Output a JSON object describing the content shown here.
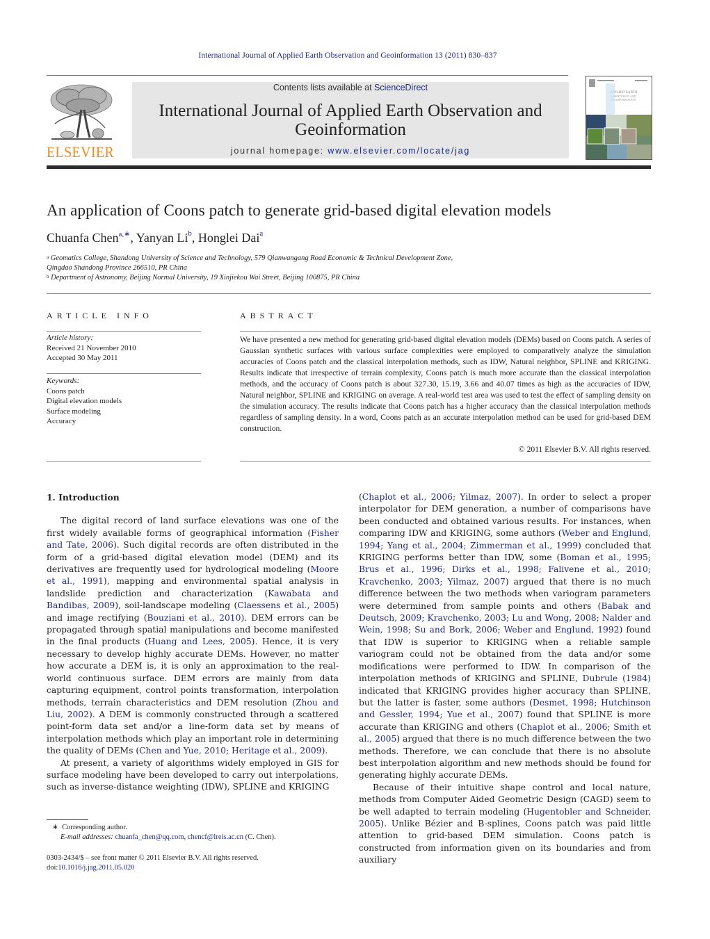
{
  "running_head": "International Journal of Applied Earth Observation and Geoinformation 13 (2011) 830–837",
  "masthead": {
    "publisher_logo_text": "ELSEVIER",
    "contents_prefix": "Contents lists available at ",
    "contents_link": "ScienceDirect",
    "journal_title": "International Journal of Applied Earth Observation and Geoinformation",
    "homepage_prefix": "journal homepage: ",
    "homepage_link": "www.elsevier.com/locate/jag",
    "cover_title": "APPLIED EARTH OBSERVATION AND GEOINFORMATION"
  },
  "article": {
    "title": "An application of Coons patch to generate grid-based digital elevation models",
    "authors": [
      {
        "name": "Chuanfa Chen",
        "sup": "a,∗"
      },
      {
        "name": "Yanyan Li",
        "sup": "b"
      },
      {
        "name": "Honglei Dai",
        "sup": "a"
      }
    ],
    "affiliations": [
      {
        "sup": "a",
        "text": "Geomatics College, Shandong University of Science and Technology, 579 Qianwangang Road Economic & Technical Development Zone,"
      },
      {
        "sup": "",
        "text": "Qingdao Shandong Province 266510, PR China"
      },
      {
        "sup": "b",
        "text": "Department of Astronomy, Beijing Normal University, 19 Xinjiekou Wai Street, Beijing 100875, PR China"
      }
    ]
  },
  "article_info": {
    "heading": "ARTICLE INFO",
    "history_label": "Article history:",
    "received": "Received 21 November 2010",
    "accepted": "Accepted 30 May 2011",
    "keywords_label": "Keywords:",
    "keywords": [
      "Coons patch",
      "Digital elevation models",
      "Surface modeling",
      "Accuracy"
    ]
  },
  "abstract": {
    "heading": "ABSTRACT",
    "text": "We have presented a new method for generating grid-based digital elevation models (DEMs) based on Coons patch. A series of Gaussian synthetic surfaces with various surface complexities were employed to comparatively analyze the simulation accuracies of Coons patch and the classical interpolation methods, such as IDW, Natural neighbor, SPLINE and KRIGING. Results indicate that irrespective of terrain complexity, Coons patch is much more accurate than the classical interpolation methods, and the accuracy of Coons patch is about 327.30, 15.19, 3.66 and 40.07 times as high as the accuracies of IDW, Natural neighbor, SPLINE and KRIGING on average. A real-world test area was used to test the effect of sampling density on the simulation accuracy. The results indicate that Coons patch has a higher accuracy than the classical interpolation methods regardless of sampling density. In a word, Coons patch as an accurate interpolation method can be used for grid-based DEM construction.",
    "copyright": "© 2011 Elsevier B.V. All rights reserved."
  },
  "body": {
    "section_heading": "1.  Introduction",
    "left_col": {
      "p1": [
        {
          "t": "The digital record of land surface elevations was one of the first widely available forms of geographical information ("
        },
        {
          "l": "Fisher and Tate, 2006"
        },
        {
          "t": "). Such digital records are often distributed in the form of a grid-based digital elevation model (DEM) and its derivatives are frequently used for hydrological modeling ("
        },
        {
          "l": "Moore et al., 1991"
        },
        {
          "t": "), mapping and environmental spatial analysis in landslide prediction and characterization ("
        },
        {
          "l": "Kawabata and Bandibas, 2009"
        },
        {
          "t": "), soil-landscape modeling ("
        },
        {
          "l": "Claessens et al., 2005"
        },
        {
          "t": ") and image rectifying ("
        },
        {
          "l": "Bouziani et al., 2010"
        },
        {
          "t": "). DEM errors can be propagated through spatial manipulations and become manifested in the final products ("
        },
        {
          "l": "Huang and Lees, 2005"
        },
        {
          "t": "). Hence, it is very necessary to develop highly accurate DEMs. However, no matter how accurate a DEM is, it is only an approximation to the real-world continuous surface. DEM errors are mainly from data capturing equipment, control points transformation, interpolation methods, terrain characteristics and DEM resolution ("
        },
        {
          "l": "Zhou and Liu, 2002"
        },
        {
          "t": "). A DEM is commonly constructed through a scattered point-form data set and/or a line-form data set by means of interpolation methods which play an important role in determining the quality of DEMs ("
        },
        {
          "l": "Chen and Yue, 2010; Heritage et al., 2009"
        },
        {
          "t": ")."
        }
      ],
      "p2": [
        {
          "t": "At present, a variety of algorithms widely employed in GIS for surface modeling have been developed to carry out interpolations, such as inverse-distance weighting (IDW), SPLINE and KRIGING"
        }
      ]
    },
    "right_col": {
      "p1": [
        {
          "t": "("
        },
        {
          "l": "Chaplot et al., 2006; Yilmaz, 2007"
        },
        {
          "t": "). In order to select a proper interpolator for DEM generation, a number of comparisons have been conducted and obtained various results. For instances, when comparing IDW and KRIGING, some authors ("
        },
        {
          "l": "Weber and Englund, 1994; Yang et al., 2004; Zimmerman et al., 1999"
        },
        {
          "t": ") concluded that KRIGING performs better than IDW, some ("
        },
        {
          "l": "Boman et al., 1995; Brus et al., 1996; Dirks et al., 1998; Falivene et al., 2010; Kravchenko, 2003; Yilmaz, 2007"
        },
        {
          "t": ") argued that there is no much difference between the two methods when variogram parameters were determined from sample points and others ("
        },
        {
          "l": "Babak and Deutsch, 2009; Kravchenko, 2003; Lu and Wong, 2008; Nalder and Wein, 1998; Su and Bork, 2006; Weber and Englund, 1992"
        },
        {
          "t": ") found that IDW is superior to KRIGING when a reliable sample variogram could not be obtained from the data and/or some modifications were performed to IDW. In comparison of the interpolation methods of KRIGING and SPLINE, "
        },
        {
          "l": "Dubrule (1984)"
        },
        {
          "t": " indicated that KRIGING provides higher accuracy than SPLINE, but the latter is faster, some authors ("
        },
        {
          "l": "Desmet, 1998; Hutchinson and Gessler, 1994; Yue et al., 2007"
        },
        {
          "t": ") found that SPLINE is more accurate than KRIGING and others ("
        },
        {
          "l": "Chaplot et al., 2006; Smith et al., 2005"
        },
        {
          "t": ") argued that there is no much difference between the two methods. Therefore, we can conclude that there is no absolute best interpolation algorithm and new methods should be found for generating highly accurate DEMs."
        }
      ],
      "p2": [
        {
          "t": "Because of their intuitive shape control and local nature, methods from Computer Aided Geometric Design (CAGD) seem to be well adapted to terrain modeling ("
        },
        {
          "l": "Hugentobler and Schneider, 2005"
        },
        {
          "t": "). Unlike Bézier and B-splines, Coons patch was paid little attention to grid-based DEM simulation. Coons patch is constructed from information given on its boundaries and from auxiliary"
        }
      ]
    }
  },
  "footnotes": {
    "corresponding_mark": "∗",
    "corresponding": "Corresponding author.",
    "email_label": "E-mail addresses: ",
    "email1": "chuanfa_chen@qq.com",
    "email_sep": ", ",
    "email2": "chencf@lreis.ac.cn",
    "email_suffix": " (C. Chen).",
    "issn_line": "0303-2434/$ – see front matter © 2011 Elsevier B.V. All rights reserved.",
    "doi_prefix": "doi:",
    "doi": "10.1016/j.jag.2011.05.020"
  },
  "colors": {
    "link": "#1f2a80",
    "elsevier_orange": "#f28a20",
    "masthead_bg": "#e6e6e6"
  }
}
